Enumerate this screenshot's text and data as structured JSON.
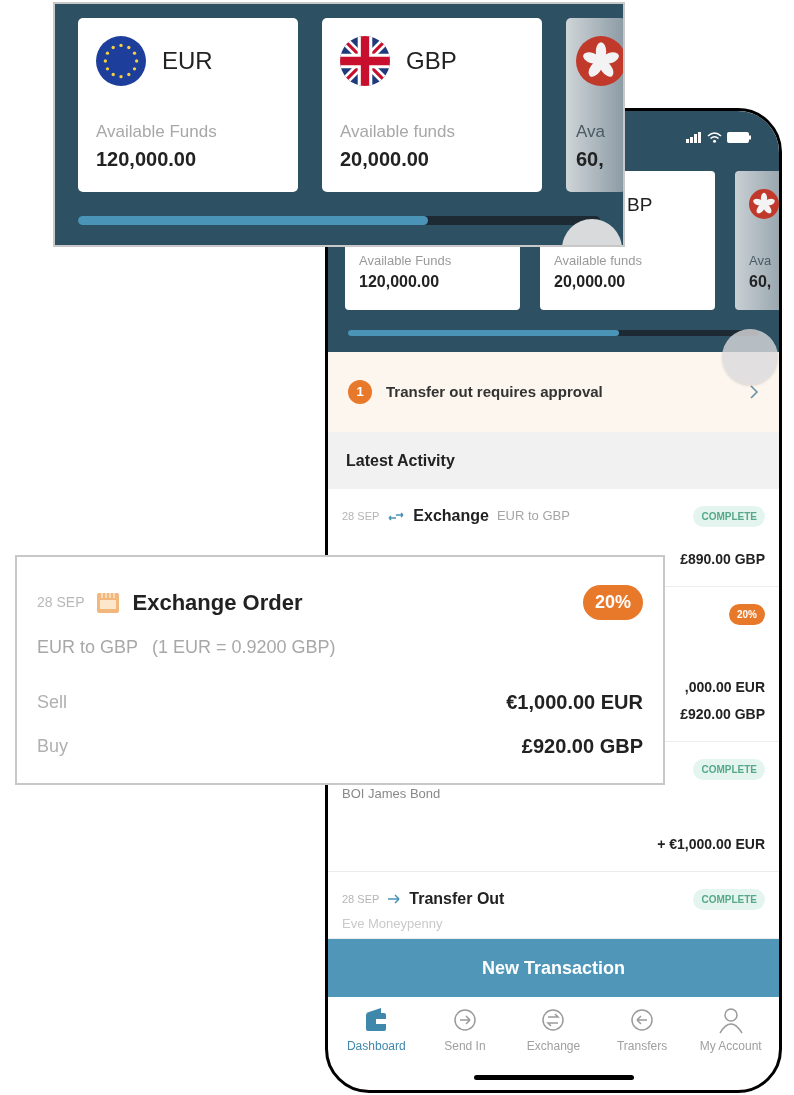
{
  "callout_balances": {
    "cards": [
      {
        "kind": "eu",
        "currency": "EUR",
        "label": "Available Funds",
        "amount": "120,000.00"
      },
      {
        "kind": "uk",
        "currency": "GBP",
        "label": "Available funds",
        "amount": "20,000.00"
      },
      {
        "kind": "hk",
        "label": "Ava",
        "amount": "60,"
      }
    ]
  },
  "phone": {
    "cards": [
      {
        "kind": "plain",
        "label": "Available Funds",
        "amount": "120,000.00"
      },
      {
        "kind": "plain",
        "currency": "BP",
        "label": "Available funds",
        "amount": "20,000.00"
      },
      {
        "kind": "hk",
        "label": "Ava",
        "amount": "60,"
      }
    ],
    "alert": {
      "count": "1",
      "text": "Transfer out requires approval"
    },
    "section_title": "Latest Activity",
    "activity": [
      {
        "kind": "exchange",
        "date": "28 SEP",
        "title": "Exchange",
        "subtitle": "EUR to GBP",
        "status": {
          "text": "COMPLETE",
          "kind": "complete"
        },
        "amounts": [
          "£890.00 GBP"
        ]
      },
      {
        "kind": "hidden",
        "status": {
          "text": "20%",
          "kind": "progress"
        },
        "amounts": [
          ",000.00 EUR",
          "£920.00 GBP"
        ]
      },
      {
        "kind": "hidden",
        "status": {
          "text": "COMPLETE",
          "kind": "complete"
        },
        "detail": "BOI James Bond",
        "amounts": [
          "+ €1,000.00 EUR"
        ]
      },
      {
        "kind": "transfer",
        "date": "28 SEP",
        "title": "Transfer Out",
        "status": {
          "text": "COMPLETE",
          "kind": "complete"
        },
        "detail": "Eve Moneypenny"
      }
    ],
    "action_button": "New Transaction",
    "tabs": [
      {
        "label": "Dashboard",
        "selected": true
      },
      {
        "label": "Send In",
        "selected": false
      },
      {
        "label": "Exchange",
        "selected": false
      },
      {
        "label": "Transfers",
        "selected": false
      },
      {
        "label": "My Account",
        "selected": false
      }
    ]
  },
  "callout_order": {
    "date": "28 SEP",
    "title": "Exchange Order",
    "status": {
      "text": "20%",
      "kind": "progress"
    },
    "pair": "EUR to GBP",
    "rate": "(1 EUR = 0.9200 GBP)",
    "lines": [
      {
        "label": "Sell",
        "amount": "€1,000.00 EUR"
      },
      {
        "label": "Buy",
        "amount": "£920.00 GBP"
      }
    ]
  }
}
